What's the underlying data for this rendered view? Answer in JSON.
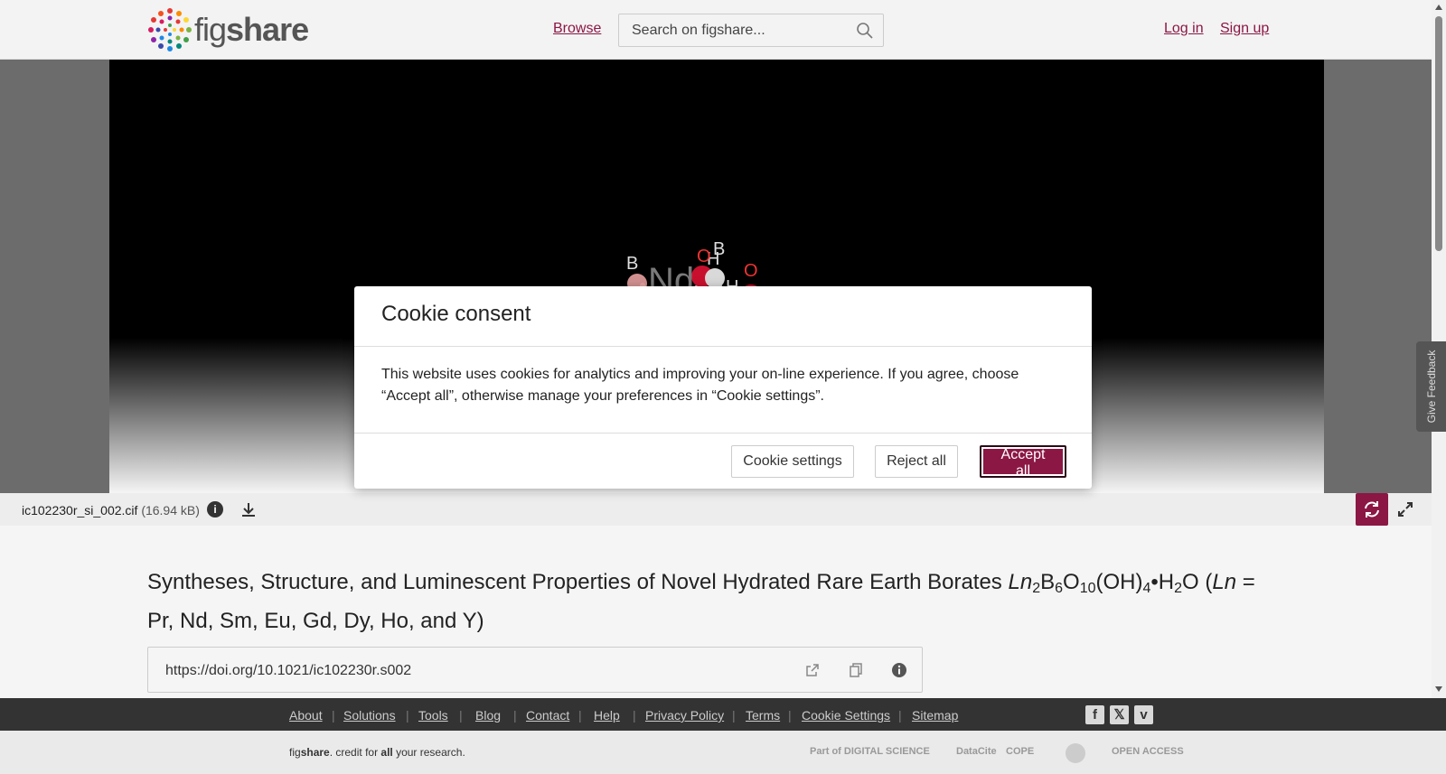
{
  "header": {
    "logo_word_light": "fig",
    "logo_word_bold": "share",
    "browse_label": "Browse",
    "search_placeholder": "Search on figshare...",
    "login_label": "Log in",
    "signup_label": "Sign up"
  },
  "viewer": {
    "feedback_label": "Give Feedback",
    "atoms": [
      "B",
      "Nd",
      "O",
      "O",
      "H",
      "B",
      "O",
      "H",
      "O",
      "O"
    ]
  },
  "file": {
    "name": "ic102230r_si_002.cif",
    "size": "(16.94 kB)"
  },
  "title": {
    "part1": "Syntheses, Structure, and Luminescent Properties of Novel Hydrated Rare Earth Borates ",
    "ln": "Ln",
    "s2": "2",
    "b": "B",
    "s6": "6",
    "o": "O",
    "s10": "10",
    "oh": "(OH)",
    "s4": "4",
    "bullet_h": "•H",
    "s2b": "2",
    "o_paren": "O (",
    "ln2": "Ln",
    "part2": " = Pr, Nd, Sm, Eu, Gd, Dy, Ho, and Y)"
  },
  "doi": {
    "url": "https://doi.org/10.1021/ic102230r.s002"
  },
  "footer": {
    "links": [
      "About",
      "Solutions",
      "Tools",
      "Blog",
      "Contact",
      "Help",
      "Privacy Policy",
      "Terms",
      "Cookie Settings",
      "Sitemap"
    ],
    "tagline_fig": "fig",
    "tagline_share": "share",
    "tagline_mid": ". credit for ",
    "tagline_all": "all",
    "tagline_end": " your research.",
    "partners": [
      "Part of DIGITAL SCIENCE",
      "DataCite",
      "COPE",
      "",
      "OPEN ACCESS"
    ]
  },
  "cookie": {
    "title": "Cookie consent",
    "body": "This website uses cookies for analytics and improving your on-line experience. If you agree, choose “Accept all”, otherwise manage your preferences in “Cookie settings”.",
    "settings_label": "Cookie settings",
    "reject_label": "Reject all",
    "accept_label": "Accept all"
  },
  "colors": {
    "brand": "#8b1744",
    "footer_dark": "#333333"
  }
}
